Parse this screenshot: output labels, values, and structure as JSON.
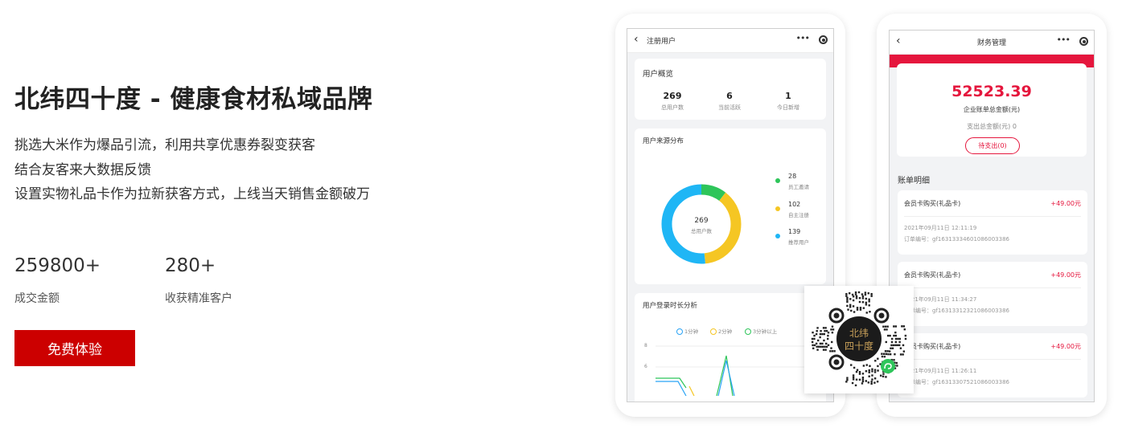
{
  "hero": {
    "title": "北纬四十度 - 健康食材私域品牌",
    "lines": [
      "挑选大米作为爆品引流，利用共享优惠券裂变获客",
      "结合友客来大数据反馈",
      "设置实物礼品卡作为拉新获客方式，上线当天销售金额破万"
    ],
    "stats": [
      {
        "value": "259800+",
        "label": "成交金额"
      },
      {
        "value": "280+",
        "label": "收获精准客户"
      }
    ],
    "cta_label": "免费体验"
  },
  "phone_users": {
    "nav_title": "注册用户",
    "back_icon": "‹",
    "more_icon": "•••",
    "overview": {
      "title": "用户概览",
      "items": [
        {
          "value": "269",
          "label": "总用户数"
        },
        {
          "value": "6",
          "label": "当前活跃"
        },
        {
          "value": "1",
          "label": "今日新增"
        }
      ]
    },
    "source": {
      "title": "用户来源分布",
      "center_value": "269",
      "center_label": "总用户数",
      "segments": [
        {
          "value": "28",
          "label": "员工邀请",
          "color": "#2ec55a",
          "share": 0.104
        },
        {
          "value": "102",
          "label": "自主注册",
          "color": "#f5c623",
          "share": 0.379
        },
        {
          "value": "139",
          "label": "推荐用户",
          "color": "#1fb6f5",
          "share": 0.517
        }
      ]
    },
    "login": {
      "title": "用户登录时长分析",
      "legend": [
        {
          "label": "1分钟",
          "color": "#29a3f5"
        },
        {
          "label": "2分钟",
          "color": "#f5c623"
        },
        {
          "label": "3分钟以上",
          "color": "#2ec55a"
        }
      ],
      "y_ticks": [
        "8",
        "6"
      ]
    }
  },
  "phone_finance": {
    "nav_title": "财务管理",
    "back_icon": "‹",
    "more_icon": "•••",
    "amount": "52523.39",
    "amount_label": "企业账单总金额(元)",
    "expense_label": "支出总金额(元) 0",
    "pending_label": "待支出(0)",
    "bill_head": "账单明细",
    "bills": [
      {
        "title": "会员卡购买(礼品卡)",
        "amount": "+49.00元",
        "date": "2021年09月11日 12:11:19",
        "order": "订单编号：gf1631333460108600338​6"
      },
      {
        "title": "会员卡购买(礼品卡)",
        "amount": "+49.00元",
        "date": "2021年09月11日 11:34:27",
        "order": "订单编号：gf1631331232108600338​6"
      },
      {
        "title": "会员卡购买(礼品卡)",
        "amount": "+49.00元",
        "date": "2021年09月11日 11:26:11",
        "order": "订单编号：gf1631330752108600338​6"
      }
    ]
  },
  "qr": {
    "logo_text": "北纬四十度",
    "accent": "#222222"
  }
}
